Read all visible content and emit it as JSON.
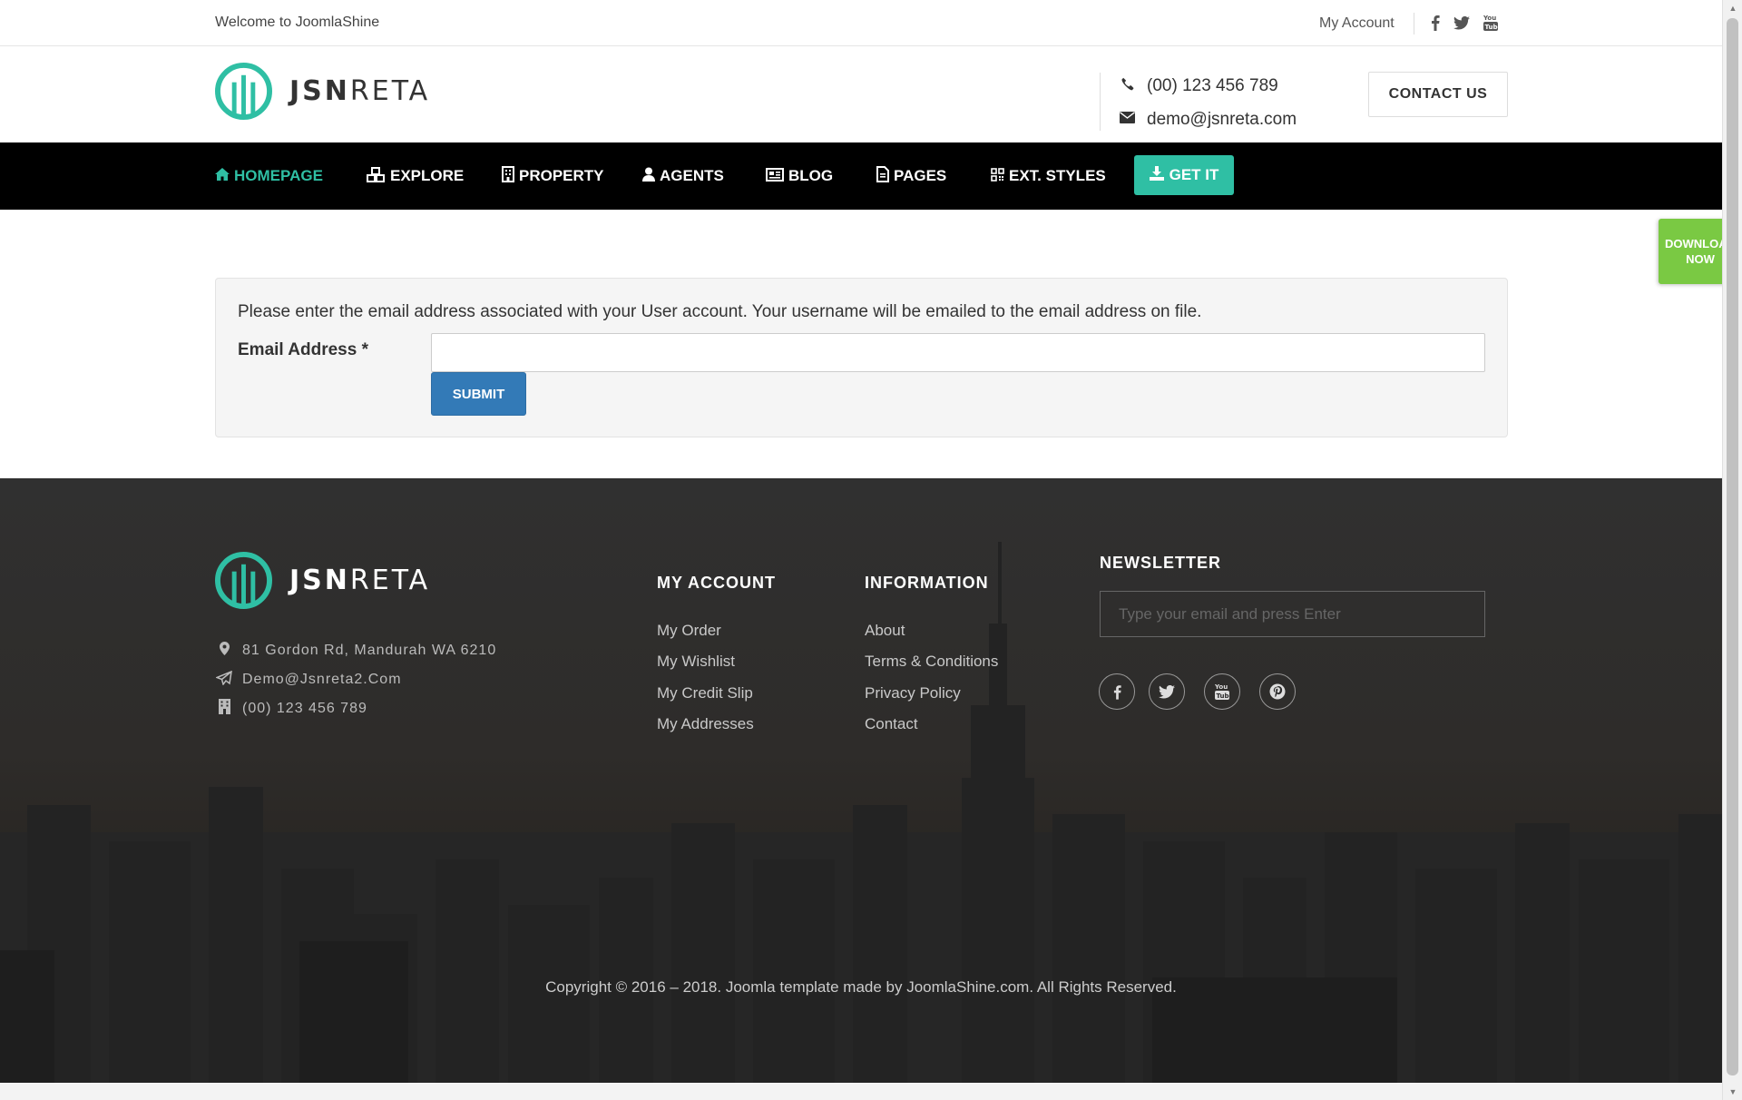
{
  "topbar": {
    "welcome": "Welcome to JoomlaShine",
    "my_account": "My Account",
    "social": [
      "facebook-icon",
      "twitter-icon",
      "youtube-icon"
    ]
  },
  "header": {
    "logo_bold": "JSN",
    "logo_light": "RETA",
    "phone": "(00) 123 456 789",
    "email": "demo@jsnreta.com",
    "contact_button": "CONTACT US"
  },
  "nav": {
    "items": [
      {
        "label": "HOMEPAGE",
        "icon": "home-icon"
      },
      {
        "label": "EXPLORE",
        "icon": "cubes-icon"
      },
      {
        "label": "PROPERTY",
        "icon": "building-icon"
      },
      {
        "label": "AGENTS",
        "icon": "user-icon"
      },
      {
        "label": "BLOG",
        "icon": "newspaper-icon"
      },
      {
        "label": "PAGES",
        "icon": "file-icon"
      },
      {
        "label": "EXT. STYLES",
        "icon": "qrcode-icon"
      }
    ],
    "get_it": "GET IT",
    "accent_color": "#2fbfa4"
  },
  "download_tab": {
    "line1": "DOWNLOAD",
    "line2": "NOW",
    "color": "#7ac943"
  },
  "form": {
    "intro": "Please enter the email address associated with your User account. Your username will be emailed to the email address on file.",
    "email_label": "Email Address *",
    "email_value": "",
    "submit": "SUBMIT",
    "submit_color": "#337ab7"
  },
  "footer": {
    "logo_bold": "JSN",
    "logo_light": "RETA",
    "address": "81 Gordon Rd, Mandurah WA 6210",
    "email": "Demo@Jsnreta2.Com",
    "phone": "(00) 123 456 789",
    "my_account": {
      "title": "MY ACCOUNT",
      "links": [
        "My Order",
        "My Wishlist",
        "My Credit Slip",
        "My Addresses"
      ]
    },
    "information": {
      "title": "INFORMATION",
      "links": [
        "About",
        "Terms & Conditions",
        "Privacy Policy",
        "Contact"
      ]
    },
    "newsletter": {
      "title": "NEWSLETTER",
      "placeholder": "Type your email and press Enter"
    },
    "social": [
      "facebook-icon",
      "twitter-icon",
      "youtube-icon",
      "pinterest-icon"
    ],
    "copyright": "Copyright © 2016 – 2018. Joomla template made by JoomlaShine.com. All Rights Reserved."
  }
}
